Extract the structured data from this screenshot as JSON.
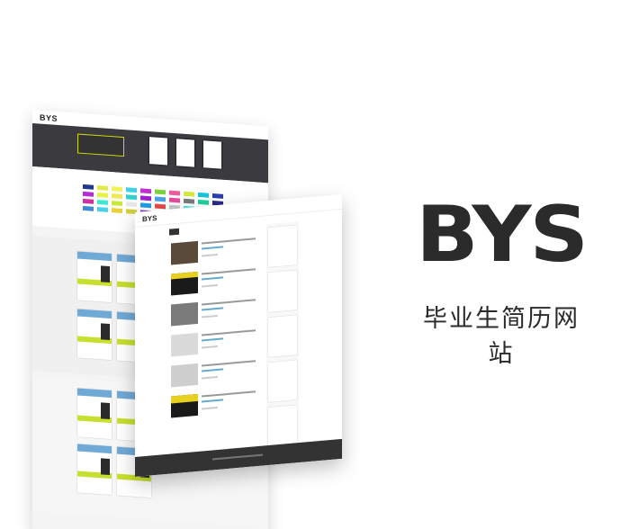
{
  "brand": {
    "logo": "BYS",
    "subtitle": "毕业生简历网站"
  },
  "mockup_back": {
    "logo": "BYS",
    "nav": [
      "",
      "",
      "",
      ""
    ],
    "swatch_colors": [
      "#1f3a8a",
      "#e5e84a",
      "#f2f25a",
      "#3fd1e6",
      "#c42fd1",
      "#7cd13f",
      "#f05a9a",
      "#d2e83a",
      "#19c5d8",
      "#2a40b0",
      "#b22fd1",
      "#e8f04a",
      "#f0e85a",
      "#2fd1c8",
      "#a01fd1",
      "#4aa0e8",
      "#e84a9a",
      "#7a7a7a",
      "#1fd19e",
      "#2a2a8a",
      "#d12fa0",
      "#3fe8d1",
      "#c8e83a",
      "#e8e8e8",
      "#1f9ee8",
      "#e84a4a",
      "#c8c8c8",
      "#4ae8e8",
      "#7a3fd1",
      "#1f1f8a",
      "#3f8ad1",
      "#4ad1e8",
      "#e8d13a",
      "#d1d13f",
      "#8a3fd1",
      "#e83a5a",
      "#d1e83f",
      "#3a3ad1",
      "#2f2f6f",
      "#1a1a1a"
    ]
  },
  "mockup_front": {
    "logo": "BYS",
    "tabs": [
      "",
      "",
      ""
    ]
  }
}
